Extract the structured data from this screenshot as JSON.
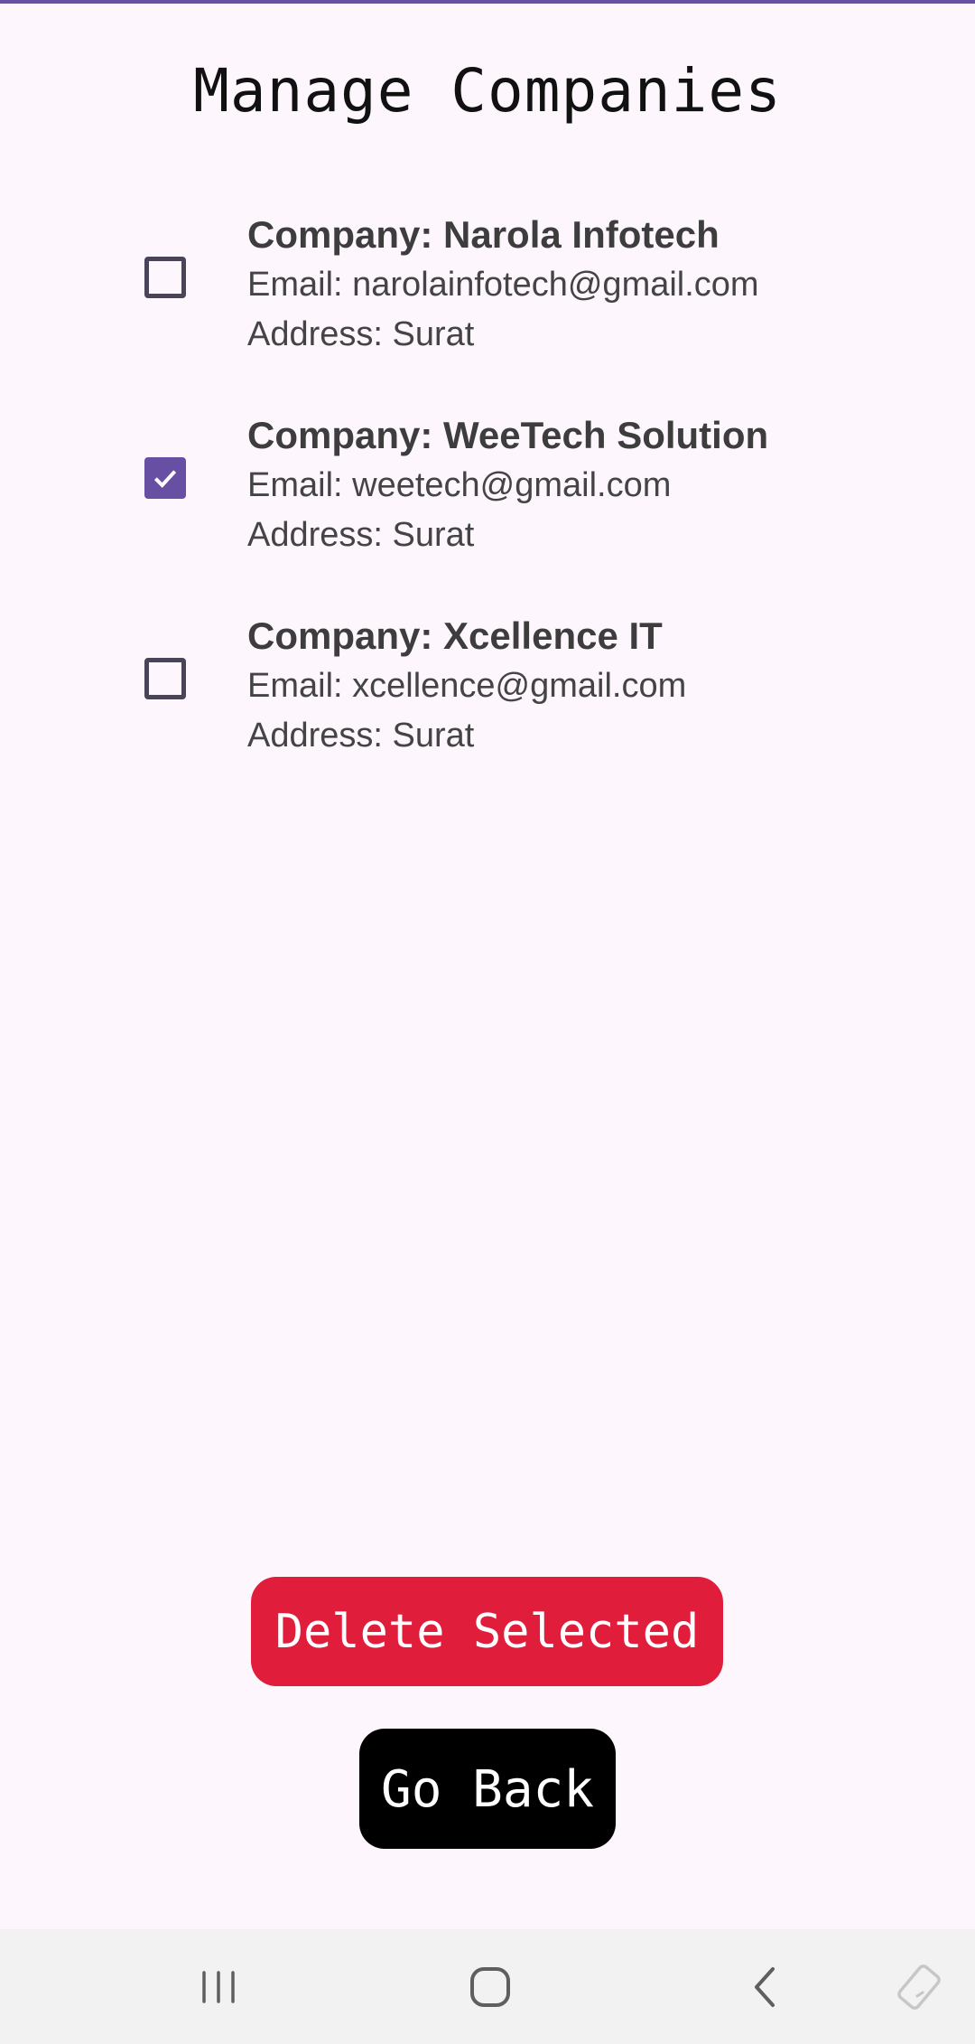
{
  "header": {
    "title": "Manage Companies"
  },
  "companies": [
    {
      "name": "Company: Narola Infotech",
      "email": "Email: narolainfotech@gmail.com",
      "address": "Address: Surat",
      "checked": false
    },
    {
      "name": "Company: WeeTech Solution",
      "email": "Email: weetech@gmail.com",
      "address": "Address: Surat",
      "checked": true
    },
    {
      "name": "Company: Xcellence IT",
      "email": "Email: xcellence@gmail.com",
      "address": "Address: Surat",
      "checked": false
    }
  ],
  "actions": {
    "delete_label": "Delete Selected",
    "back_label": "Go Back"
  },
  "nav": {
    "icons": [
      "recent-apps-icon",
      "home-icon",
      "back-icon",
      "rotate-icon"
    ]
  },
  "colors": {
    "accent": "#6750a4",
    "delete": "#e11d3c",
    "back": "#000000",
    "background": "#fdf6fd"
  }
}
